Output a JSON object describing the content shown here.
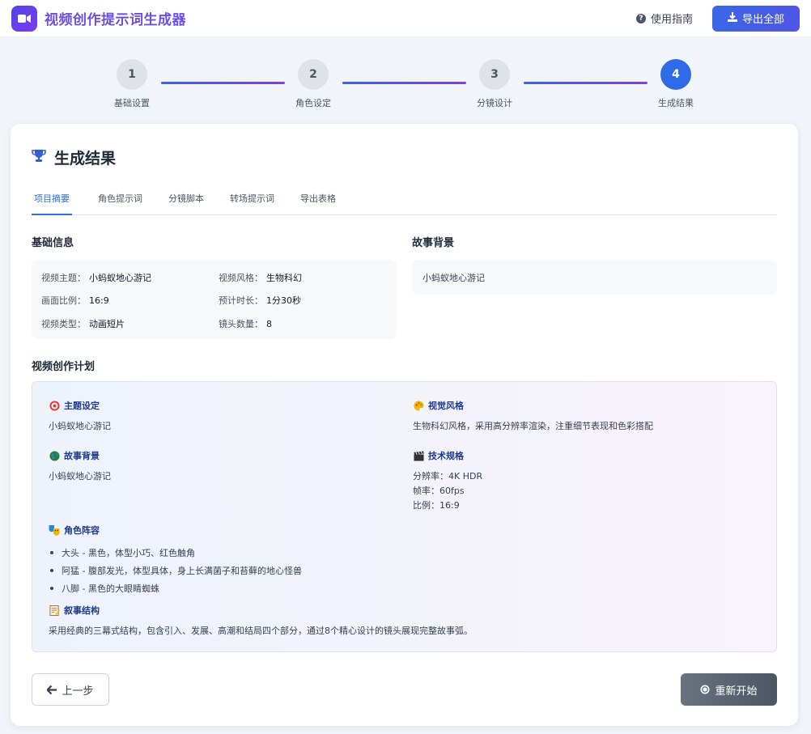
{
  "header": {
    "app_title": "视频创作提示词生成器",
    "guide_label": "使用指南",
    "export_label": "导出全部"
  },
  "steps": [
    {
      "num": "1",
      "label": "基础设置"
    },
    {
      "num": "2",
      "label": "角色设定"
    },
    {
      "num": "3",
      "label": "分镜设计"
    },
    {
      "num": "4",
      "label": "生成结果"
    }
  ],
  "card": {
    "title": "生成结果",
    "tabs": [
      "项目摘要",
      "角色提示词",
      "分镜脚本",
      "转场提示词",
      "导出表格"
    ],
    "basic_title": "基础信息",
    "basic": {
      "theme_label": "视频主题：",
      "theme_value": "小蚂蚁地心游记",
      "style_label": "视频风格：",
      "style_value": "生物科幻",
      "ratio_label": "画面比例：",
      "ratio_value": "16:9",
      "duration_label": "预计时长：",
      "duration_value": "1分30秒",
      "type_label": "视频类型：",
      "type_value": "动画短片",
      "shots_label": "镜头数量：",
      "shots_value": "8"
    },
    "story_title": "故事背景",
    "story_text": "小蚂蚁地心游记",
    "plan_title": "视频创作计划",
    "plan": {
      "theme_h": "主题设定",
      "theme_t": "小蚂蚁地心游记",
      "visual_h": "视觉风格",
      "visual_t": "生物科幻风格，采用高分辨率渲染，注重细节表现和色彩搭配",
      "story_h": "故事背景",
      "story_t": "小蚂蚁地心游记",
      "tech_h": "技术规格",
      "tech_1": "分辨率：4K HDR",
      "tech_2": "帧率：60fps",
      "tech_3": "比例：16:9",
      "cast_h": "角色阵容",
      "cast": [
        "大头 - 黑色，体型小巧、红色触角",
        "阿猛 - 腹部发光，体型具体，身上长满菌子和苔藓的地心怪兽",
        "八脚 - 黑色的大眼睛蜘蛛"
      ],
      "narr_h": "叙事结构",
      "narr_t": "采用经典的三幕式结构，包含引入、发展、高潮和结局四个部分，通过8个精心设计的镜头展现完整故事弧。"
    },
    "prev_label": "上一步",
    "restart_label": "重新开始"
  }
}
